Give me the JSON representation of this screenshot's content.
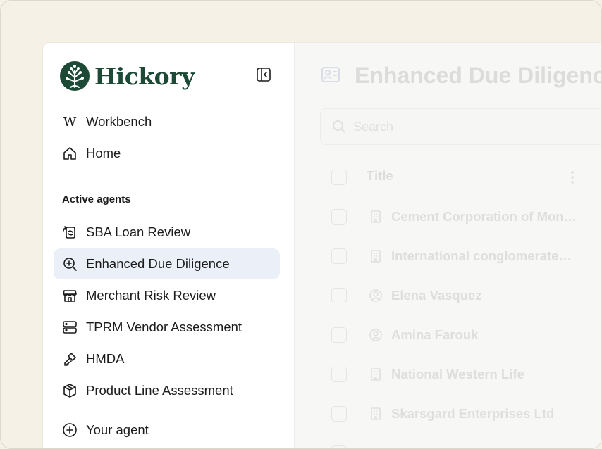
{
  "app": {
    "name": "Hickory"
  },
  "sidebar": {
    "top_items": [
      {
        "label": "Workbench",
        "icon": "workbench-icon"
      },
      {
        "label": "Home",
        "icon": "home-icon"
      }
    ],
    "section_label": "Active agents",
    "agents": [
      {
        "label": "SBA Loan Review",
        "icon": "refresh-document-icon"
      },
      {
        "label": "Enhanced Due Diligence",
        "icon": "zoom-in-icon",
        "active": true
      },
      {
        "label": "Merchant Risk Review",
        "icon": "storefront-icon"
      },
      {
        "label": "TPRM Vendor Assessment",
        "icon": "server-icon"
      },
      {
        "label": "HMDA",
        "icon": "key-icon"
      },
      {
        "label": "Product Line Assessment",
        "icon": "package-icon"
      }
    ],
    "bottom_item": {
      "label": "Your agent",
      "icon": "plus-circle-icon"
    }
  },
  "main": {
    "title": "Enhanced Due Diligence",
    "search_placeholder": "Search",
    "table": {
      "header": "Title",
      "rows": [
        {
          "title": "Cement Corporation of Mon…",
          "icon": "building-icon"
        },
        {
          "title": "International conglomerate…",
          "icon": "building-icon"
        },
        {
          "title": "Elena Vasquez",
          "icon": "person-icon"
        },
        {
          "title": "Amina Farouk",
          "icon": "person-icon"
        },
        {
          "title": "National Western Life",
          "icon": "building-icon"
        },
        {
          "title": "Skarsgard Enterprises Ltd",
          "icon": "building-icon"
        }
      ]
    }
  },
  "colors": {
    "brand": "#1c4a36",
    "active_bg": "#eaeff8",
    "page_bg": "#f5f1e6"
  }
}
